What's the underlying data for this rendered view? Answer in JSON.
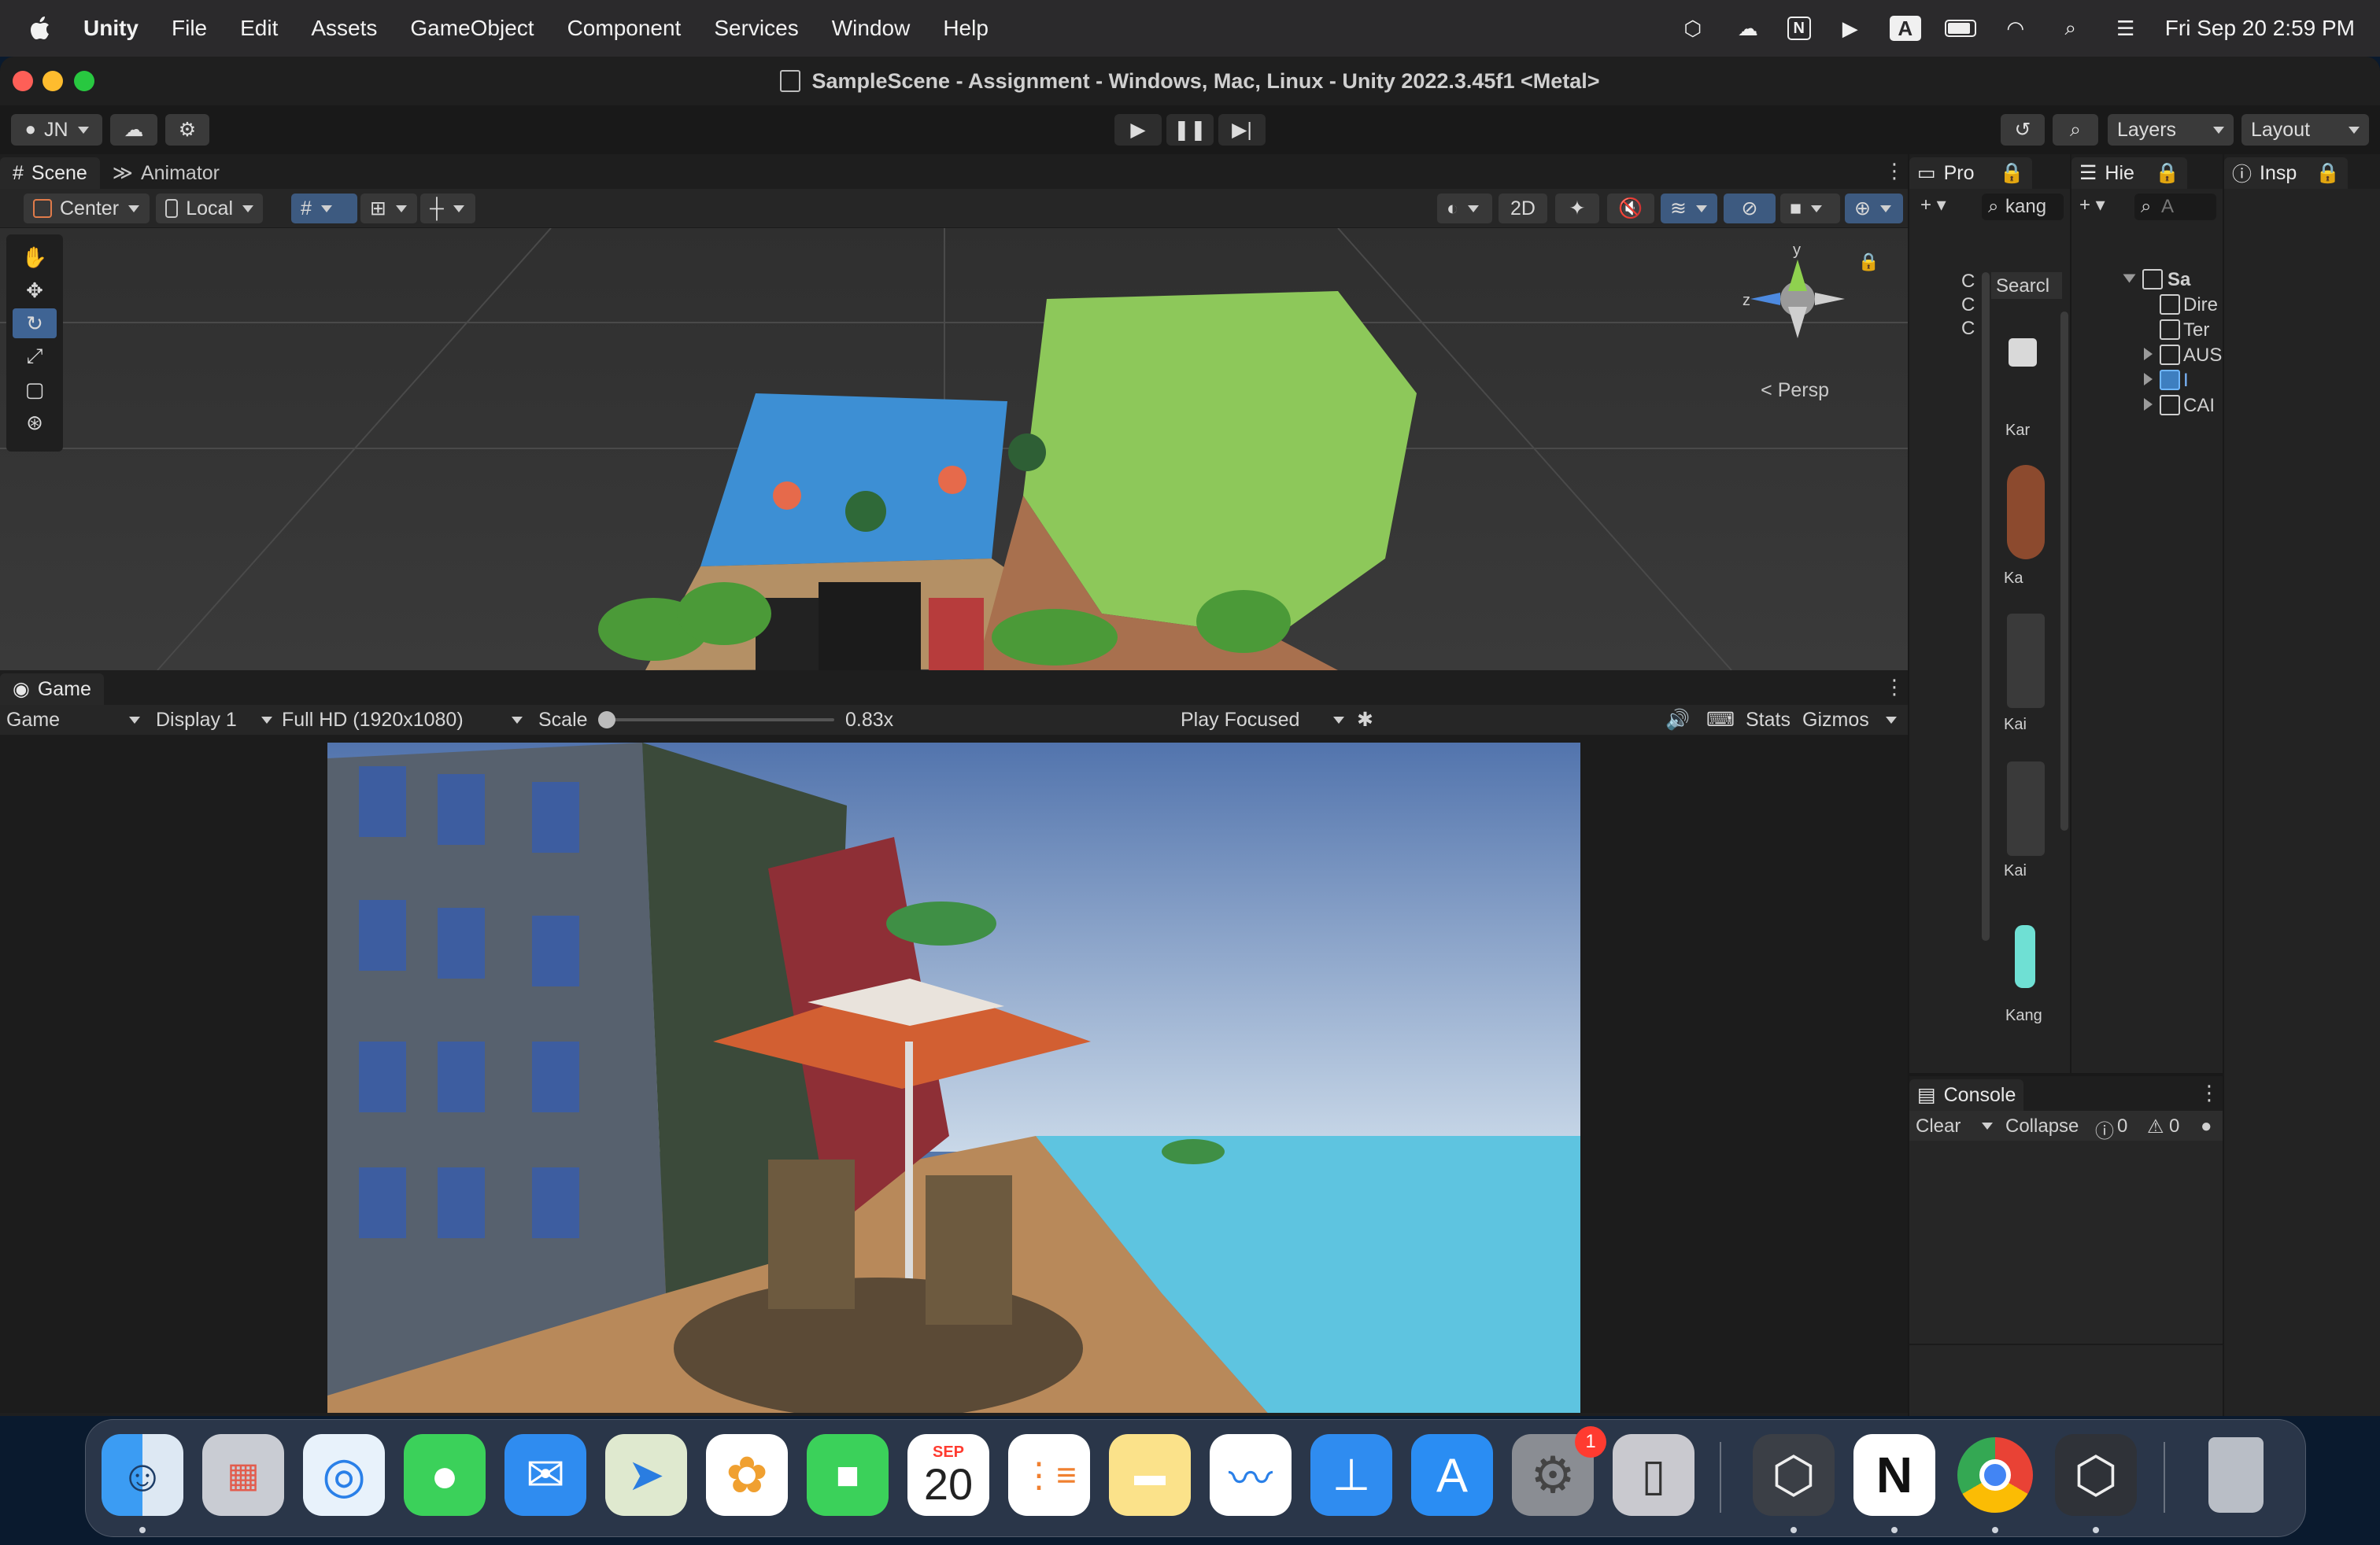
{
  "menubar": {
    "app_name": "Unity",
    "items": [
      "File",
      "Edit",
      "Assets",
      "GameObject",
      "Component",
      "Services",
      "Window",
      "Help"
    ],
    "input_badge": "A",
    "clock": "Fri Sep 20  2:59 PM"
  },
  "window": {
    "title": "SampleScene - Assignment - Windows, Mac, Linux - Unity 2022.3.45f1 <Metal>"
  },
  "toolbar": {
    "account": "JN",
    "layers_label": "Layers",
    "layout_label": "Layout"
  },
  "scene": {
    "tabs": [
      "Scene",
      "Animator"
    ],
    "pivot_label": "Center",
    "space_label": "Local",
    "mode_2d": "2D",
    "persp_label": "Persp",
    "gizmo_axes": {
      "y": "y",
      "z": "z"
    }
  },
  "game": {
    "tab": "Game",
    "view_select": "Game",
    "display_select": "Display 1",
    "resolution_select": "Full HD (1920x1080)",
    "scale_label": "Scale",
    "scale_value": "0.83x",
    "scale_fraction": 0.0,
    "play_mode_select": "Play Focused",
    "stats_label": "Stats",
    "gizmos_label": "Gizmos"
  },
  "project": {
    "tab": "Pro",
    "search_value": "kang",
    "search_header": "Searcl",
    "tree_letters": [
      "C",
      "C",
      "C"
    ],
    "assets": [
      "Kar",
      "Ka",
      "Kai",
      "Kai",
      "Kang"
    ]
  },
  "hierarchy": {
    "tab": "Hie",
    "search_placeholder": "A",
    "scene_name": "Sa",
    "items": [
      "Dire",
      "Ter",
      "AUS",
      "I",
      "CAI"
    ]
  },
  "inspector": {
    "tab": "Insp"
  },
  "console": {
    "tab": "Console",
    "clear_label": "Clear",
    "collapse_label": "Collapse",
    "info_count": "0",
    "warn_count": "0"
  },
  "dock": {
    "calendar_month": "SEP",
    "calendar_day": "20",
    "settings_badge": "1",
    "apps": [
      "finder-icon",
      "launchpad-icon",
      "safari-icon",
      "messages-icon",
      "mail-icon",
      "maps-icon",
      "photos-icon",
      "facetime-icon",
      "calendar-icon",
      "reminders-icon",
      "notes-icon",
      "freeform-icon",
      "keynote-icon",
      "app-store-icon",
      "system-settings-icon",
      "iphone-mirroring-icon",
      "unity-hub-icon",
      "notion-icon",
      "chrome-icon",
      "unity-icon",
      "trash-icon"
    ]
  },
  "colors": {
    "accent_blue": "#3f6494",
    "panel": "#282828",
    "background": "#191919"
  }
}
